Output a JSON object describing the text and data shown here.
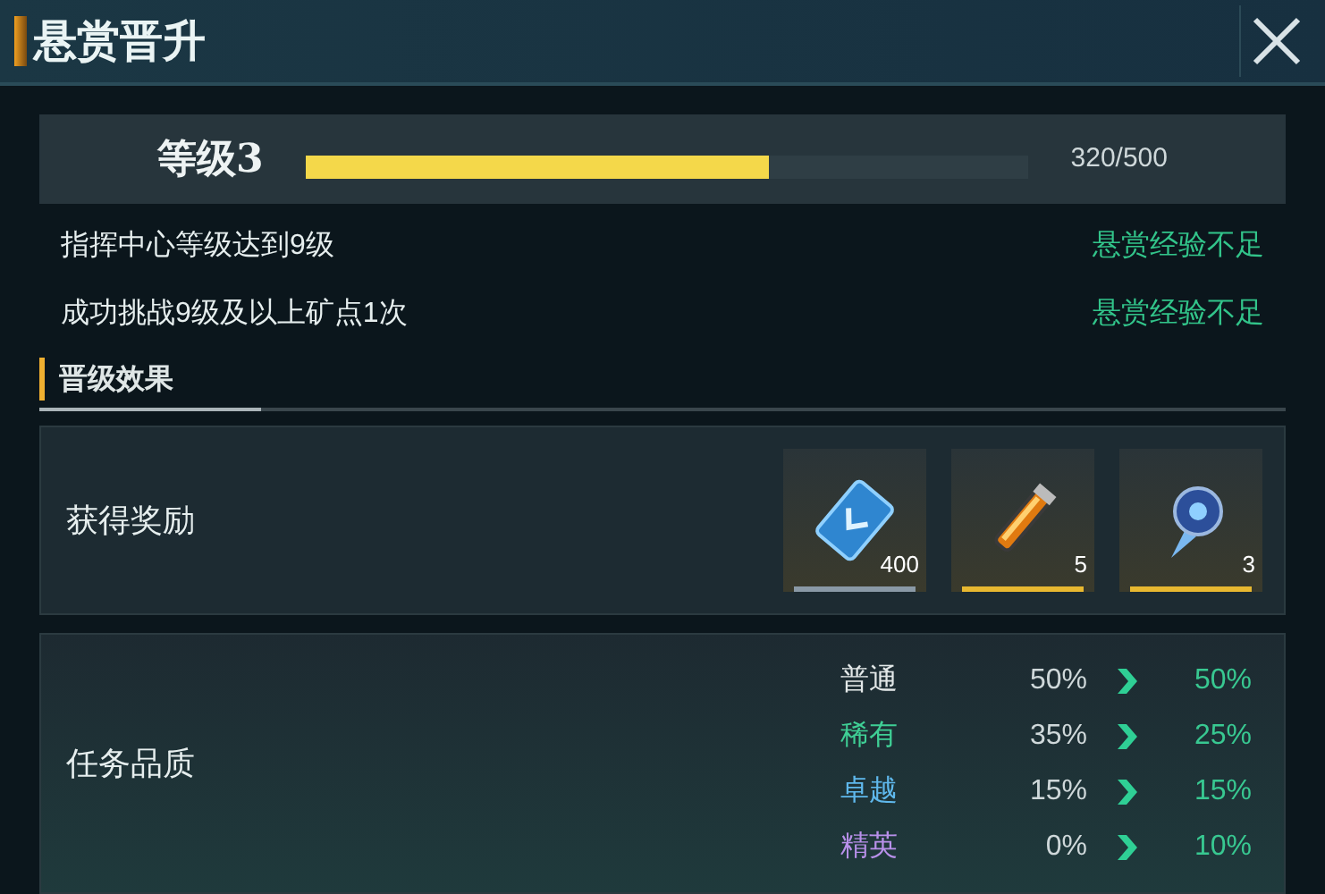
{
  "window": {
    "title": "悬赏晋升"
  },
  "level": {
    "label": "等级3",
    "level": 0.64,
    "reading": "320/500"
  },
  "requirements": [
    {
      "text": "指挥中心等级达到9级",
      "status": "悬赏经验不足"
    },
    {
      "text": "成功挑战9级及以上矿点1次",
      "status": "悬赏经验不足"
    }
  ],
  "section": {
    "title": "晋级效果"
  },
  "rewards": {
    "label": "获得奖励",
    "items": [
      {
        "kind": "card",
        "count": "400",
        "color": "#8a99a6"
      },
      {
        "kind": "tube",
        "count": "5",
        "color": "#e8b830"
      },
      {
        "kind": "crystal",
        "count": "3",
        "color": "#e8b830"
      }
    ]
  },
  "quality": {
    "label": "任务品质",
    "rows": [
      {
        "name": "普通",
        "color": "#e3e8e8",
        "from": "50%",
        "to": "50%"
      },
      {
        "name": "稀有",
        "color": "#3fcf95",
        "from": "35%",
        "to": "25%"
      },
      {
        "name": "卓越",
        "color": "#5fb8ec",
        "from": "15%",
        "to": "15%"
      },
      {
        "name": "精英",
        "color": "#b890ea",
        "from": "0%",
        "to": "10%"
      }
    ]
  }
}
